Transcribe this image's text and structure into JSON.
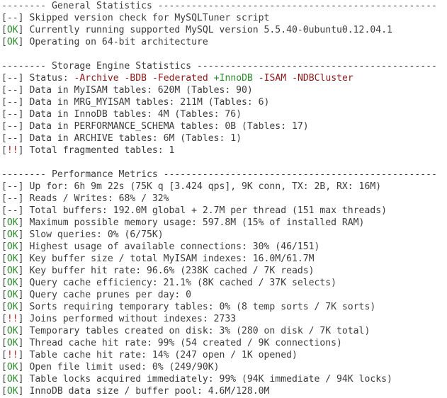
{
  "sections": [
    {
      "header": "-------- General Statistics --------------------------------------------------",
      "lines": [
        {
          "tag": "--",
          "text": "Skipped version check for MySQLTuner script"
        },
        {
          "tag": "OK",
          "text": "Currently running supported MySQL version 5.5.40-0ubuntu0.12.04.1"
        },
        {
          "tag": "OK",
          "text": "Operating on 64-bit architecture"
        }
      ]
    },
    {
      "header": "-------- Storage Engine Statistics -------------------------------------------",
      "lines": [
        {
          "tag": "--",
          "text": "Status: ",
          "engines": [
            {
              "sign": "-",
              "name": "Archive"
            },
            {
              "sign": "-",
              "name": "BDB"
            },
            {
              "sign": "-",
              "name": "Federated"
            },
            {
              "sign": "+",
              "name": "InnoDB"
            },
            {
              "sign": "-",
              "name": "ISAM"
            },
            {
              "sign": "-",
              "name": "NDBCluster"
            }
          ]
        },
        {
          "tag": "--",
          "text": "Data in MyISAM tables: 620M (Tables: 90)"
        },
        {
          "tag": "--",
          "text": "Data in MRG_MYISAM tables: 211M (Tables: 6)"
        },
        {
          "tag": "--",
          "text": "Data in InnoDB tables: 4M (Tables: 76)"
        },
        {
          "tag": "--",
          "text": "Data in PERFORMANCE_SCHEMA tables: 0B (Tables: 17)"
        },
        {
          "tag": "--",
          "text": "Data in ARCHIVE tables: 6M (Tables: 1)"
        },
        {
          "tag": "!!",
          "text": "Total fragmented tables: 1"
        }
      ]
    },
    {
      "header": "-------- Performance Metrics -------------------------------------------------",
      "lines": [
        {
          "tag": "--",
          "text": "Up for: 6h 9m 22s (75K q [3.424 qps], 9K conn, TX: 2B, RX: 16M)"
        },
        {
          "tag": "--",
          "text": "Reads / Writes: 68% / 32%"
        },
        {
          "tag": "--",
          "text": "Total buffers: 192.0M global + 2.7M per thread (151 max threads)"
        },
        {
          "tag": "OK",
          "text": "Maximum possible memory usage: 597.8M (15% of installed RAM)"
        },
        {
          "tag": "OK",
          "text": "Slow queries: 0% (6/75K)"
        },
        {
          "tag": "OK",
          "text": "Highest usage of available connections: 30% (46/151)"
        },
        {
          "tag": "OK",
          "text": "Key buffer size / total MyISAM indexes: 16.0M/61.7M"
        },
        {
          "tag": "OK",
          "text": "Key buffer hit rate: 96.6% (238K cached / 7K reads)"
        },
        {
          "tag": "OK",
          "text": "Query cache efficiency: 21.1% (8K cached / 37K selects)"
        },
        {
          "tag": "OK",
          "text": "Query cache prunes per day: 0"
        },
        {
          "tag": "OK",
          "text": "Sorts requiring temporary tables: 0% (8 temp sorts / 7K sorts)"
        },
        {
          "tag": "!!",
          "text": "Joins performed without indexes: 2733"
        },
        {
          "tag": "OK",
          "text": "Temporary tables created on disk: 3% (280 on disk / 7K total)"
        },
        {
          "tag": "OK",
          "text": "Thread cache hit rate: 99% (54 created / 9K connections)"
        },
        {
          "tag": "!!",
          "text": "Table cache hit rate: 14% (247 open / 1K opened)"
        },
        {
          "tag": "OK",
          "text": "Open file limit used: 0% (249/90K)"
        },
        {
          "tag": "OK",
          "text": "Table locks acquired immediately: 99% (94K immediate / 94K locks)"
        },
        {
          "tag": "OK",
          "text": "InnoDB data size / buffer pool: 4.6M/128.0M"
        }
      ]
    }
  ],
  "colors": {
    "background": "#ffffff",
    "text": "#3c3c3c",
    "ok": "#2b8a2b",
    "bad": "#b22222",
    "engine_disabled": "#8b1a1a",
    "engine_enabled": "#2b8a2b"
  }
}
